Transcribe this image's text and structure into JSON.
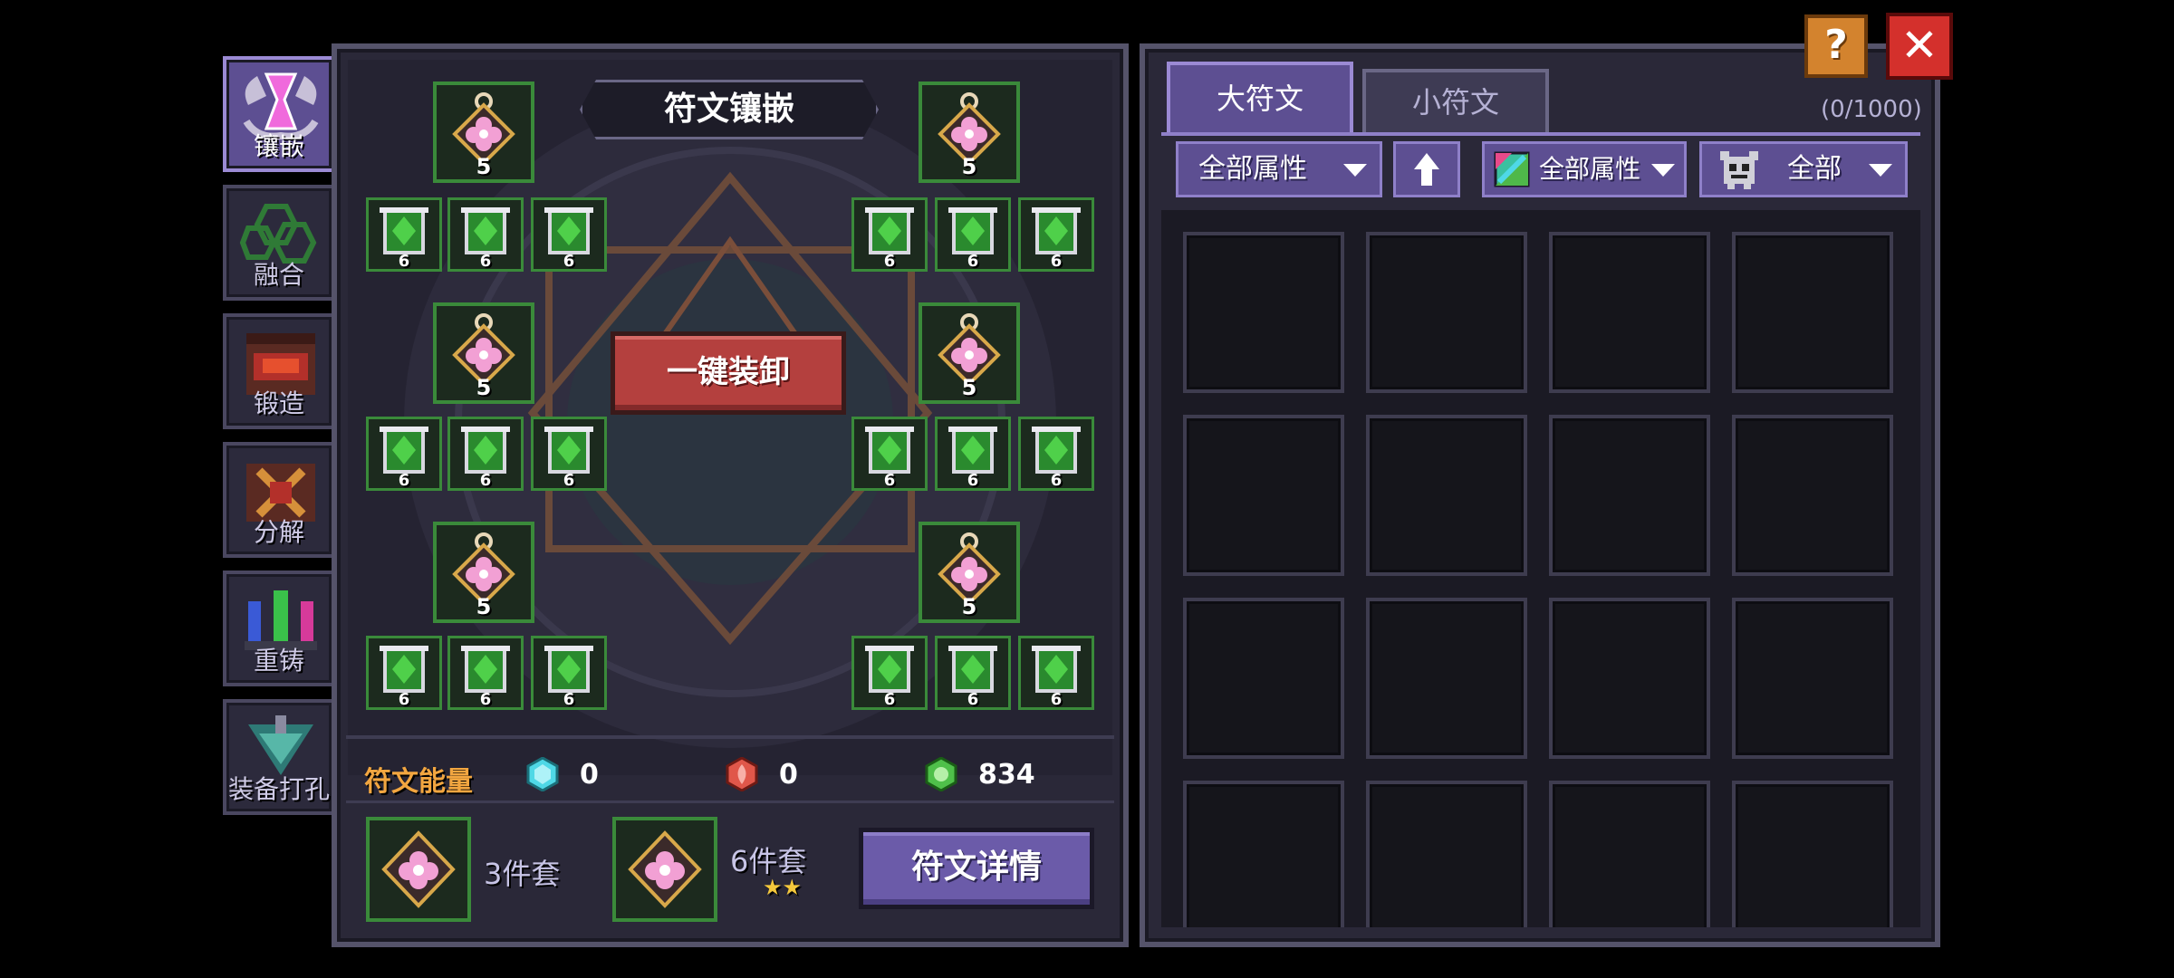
{
  "sidenav": [
    {
      "label": "镶嵌",
      "active": true
    },
    {
      "label": "融合",
      "active": false
    },
    {
      "label": "锻造",
      "active": false
    },
    {
      "label": "分解",
      "active": false
    },
    {
      "label": "重铸",
      "active": false
    },
    {
      "label": "装备打孔",
      "active": false
    }
  ],
  "left": {
    "title": "符文镶嵌",
    "unequip_all": "一键装卸",
    "big_slot_level": "5",
    "small_slot_level": "6",
    "energy_label": "符文能量",
    "energy": [
      {
        "color": "#4fd8e6",
        "value": "0"
      },
      {
        "color": "#e0574a",
        "value": "0"
      },
      {
        "color": "#4fc04a",
        "value": "834"
      }
    ],
    "set3_label": "3件套",
    "set6_label": "6件套",
    "set6_stars": "★★",
    "detail_button": "符文详情"
  },
  "right": {
    "tabs": [
      {
        "label": "大符文",
        "active": true
      },
      {
        "label": "小符文",
        "active": false
      }
    ],
    "count": "(0/1000)",
    "filter_attr": "全部属性",
    "sort_icon": "up-arrow-icon",
    "filter_color_attr": "全部属性",
    "filter_monster": "全部"
  },
  "colors": {
    "accent_purple": "#5d4f92",
    "slot_green": "#3a8a3a",
    "unequip_red": "#b4403e",
    "energy_orange": "#f2a640"
  }
}
